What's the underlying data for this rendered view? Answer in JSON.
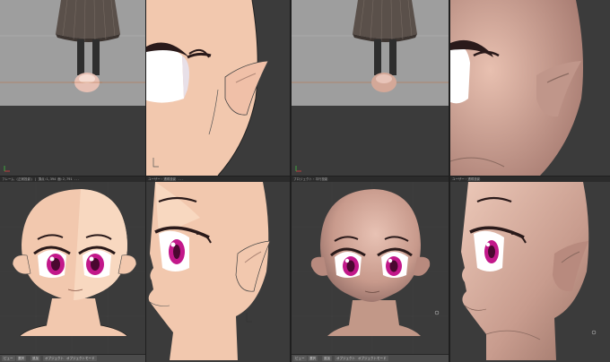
{
  "app": {
    "name": "3D modeling viewports (4-panel)"
  },
  "viewports": [
    {
      "id": "top-left",
      "view": "front-ortho",
      "header": ""
    },
    {
      "id": "top-middle",
      "view": "side-closeup",
      "header": ""
    },
    {
      "id": "top-right",
      "view": "front-ortho-shaded",
      "header": ""
    },
    {
      "id": "top-far-right",
      "view": "side-closeup-shaded",
      "header": ""
    },
    {
      "id": "bottom-left",
      "view": "front-head",
      "header": "フレーム  (正射投影)  | 頂点:1,394 面:2,791 ..."
    },
    {
      "id": "bottom-middle",
      "view": "side-head",
      "header": "ユーザー・透視投影  ..."
    },
    {
      "id": "bottom-right",
      "view": "front-head-shaded",
      "header": "プロジェクト・平行投影"
    },
    {
      "id": "bottom-far-right",
      "view": "side-head-shaded",
      "header": "ユーザー・透視投影"
    }
  ],
  "toolbar": {
    "left_items": [
      "ビュー",
      "選択",
      "追加",
      "オブジェクト",
      "オブジェクトモード"
    ],
    "right_items": [
      "ビュー",
      "選択",
      "追加",
      "オブジェクト",
      "オブジェクトモード"
    ]
  },
  "colors": {
    "viewport_bg": "#3b3b3b",
    "grid": "#454545",
    "skin_flat": "#f2c8ae",
    "skin_shaded": "#d4a898",
    "eye": "#c2188a"
  }
}
